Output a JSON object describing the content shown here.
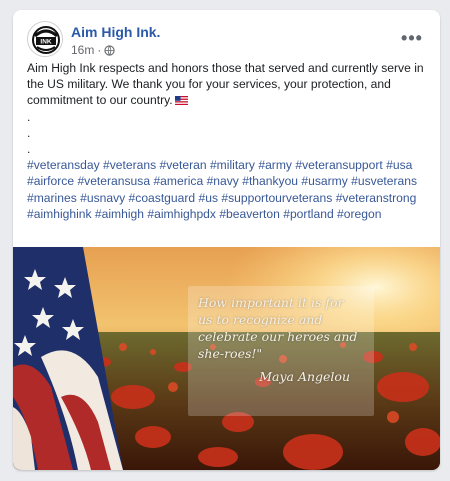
{
  "post": {
    "author": "Aim High Ink.",
    "time": "16m",
    "separator": "·",
    "avatar_text": "AIM HIGH INK",
    "body_line": "Aim High Ink respects and honors those that served and currently serve in the US military.  We thank you for your services, your protection, and commitment to our country.",
    "dots": [
      ".",
      ".",
      "."
    ],
    "hashtags": [
      "#veteransday",
      "#veterans",
      "#veteran",
      "#military",
      "#army",
      "#veteransupport",
      "#usa",
      "#airforce",
      "#veteransusa",
      "#america",
      "#navy",
      "#thankyou",
      "#usarmy",
      "#usveterans",
      "#marines",
      "#usnavy",
      "#coastguard",
      "#us",
      "#supportourveterans",
      "#veteranstrong",
      "#aimhighink",
      "#aimhigh",
      "#aimhighpdx",
      "#beaverton",
      "#portland",
      "#oregon"
    ]
  },
  "image": {
    "quote_lines": [
      "How important it is for",
      "us to recognize and",
      "celebrate our heroes and",
      "she-roes!\""
    ],
    "quote_author": "Maya Angelou"
  },
  "icons": {
    "more": "more-options-icon",
    "privacy": "globe-icon",
    "flag": "us-flag-emoji"
  },
  "colors": {
    "link": "#385898",
    "name": "#2b5aa8",
    "meta": "#65676b"
  }
}
